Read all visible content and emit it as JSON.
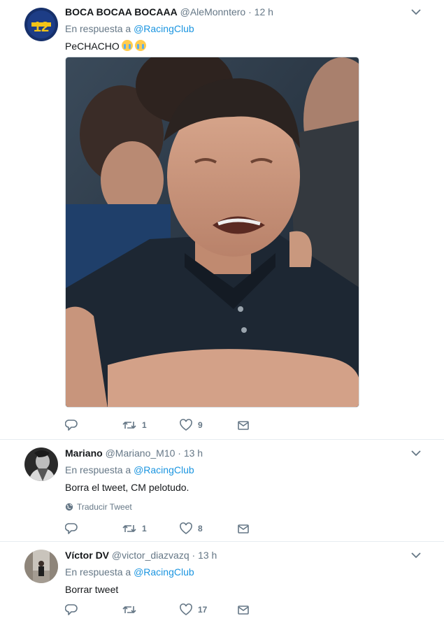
{
  "tweets": [
    {
      "fullname": "BOCA BOCAA BOCAAA",
      "handle": "@AleMonntero",
      "time": "12 h",
      "reply_prefix": "En respuesta a",
      "reply_to": "@RacingClub",
      "text": "PeCHACHO",
      "emojis": [
        "loudly-crying-face",
        "loudly-crying-face"
      ],
      "media": "photo of man crying",
      "actions": {
        "reply": "",
        "retweet": "1",
        "like": "9",
        "message": ""
      }
    },
    {
      "fullname": "Mariano",
      "handle": "@Mariano_M10",
      "time": "13 h",
      "reply_prefix": "En respuesta a",
      "reply_to": "@RacingClub",
      "text": "Borra el tweet, CM pelotudo.",
      "translate": "Traducir Tweet",
      "actions": {
        "reply": "",
        "retweet": "1",
        "like": "8",
        "message": ""
      }
    },
    {
      "fullname": "Víctor DV",
      "handle": "@victor_diazvazq",
      "time": "13 h",
      "reply_prefix": "En respuesta a",
      "reply_to": "@RacingClub",
      "text": "Borrar tweet",
      "actions": {
        "reply": "",
        "retweet": "",
        "like": "17",
        "message": ""
      }
    }
  ],
  "separator": "·",
  "colors": {
    "link": "#1b95e0",
    "meta": "#657786",
    "text": "#14171a",
    "divider": "#e6ecf0"
  }
}
